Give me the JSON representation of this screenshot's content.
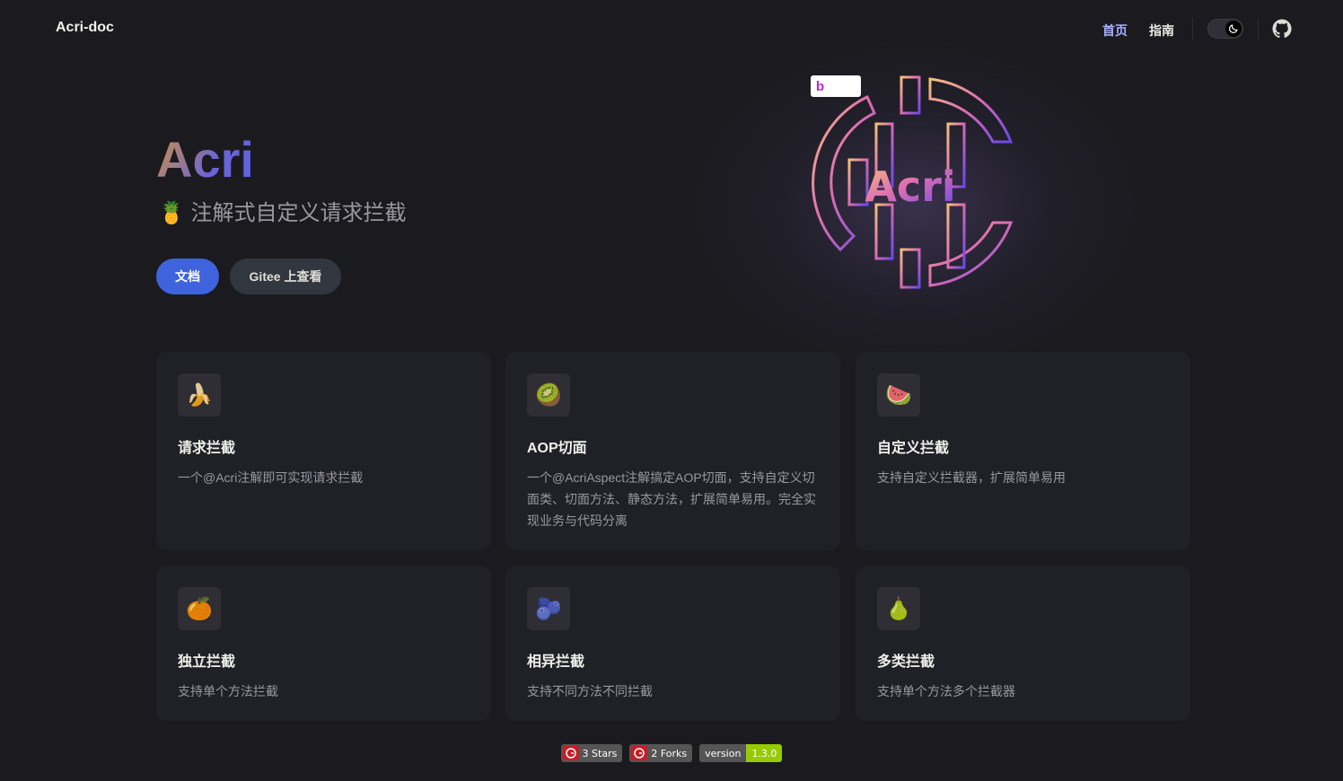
{
  "nav": {
    "brand": "Acri-doc",
    "links": [
      {
        "label": "首页",
        "active": true
      },
      {
        "label": "指南",
        "active": false
      }
    ],
    "theme_toggle_icon": "moon-icon",
    "repo_icon": "github-icon"
  },
  "hero": {
    "name": "Acri",
    "tagline_icon": "pineapple-emoji",
    "tagline": "🍍 注解式自定义请求拦截",
    "actions": [
      {
        "label": "文档",
        "theme": "brand"
      },
      {
        "label": "Gitee 上查看",
        "theme": "alt"
      }
    ],
    "logo_text": "Acri",
    "logo_badge": "b"
  },
  "features": [
    {
      "icon": "🍌",
      "title": "请求拦截",
      "details": "一个@Acri注解即可实现请求拦截"
    },
    {
      "icon": "🥝",
      "title": "AOP切面",
      "details": "一个@AcriAspect注解搞定AOP切面，支持自定义切面类、切面方法、静态方法，扩展简单易用。完全实现业务与代码分离"
    },
    {
      "icon": "🍉",
      "title": "自定义拦截",
      "details": "支持自定义拦截器，扩展简单易用"
    },
    {
      "icon": "🍊",
      "title": "独立拦截",
      "details": "支持单个方法拦截"
    },
    {
      "icon": "🫐",
      "title": "相异拦截",
      "details": "支持不同方法不同拦截"
    },
    {
      "icon": "🍐",
      "title": "多类拦截",
      "details": "支持单个方法多个拦截器"
    }
  ],
  "badges": {
    "stars": "3 Stars",
    "forks": "2 Forks",
    "version_label": "version",
    "version_value": "1.3.0"
  },
  "colors": {
    "brand": "#3e63dd",
    "nav_active": "#a8b1ff",
    "background": "#1b1b1f",
    "card": "#202127",
    "version_green": "#97ca00",
    "gitee_red": "#c71d23"
  }
}
